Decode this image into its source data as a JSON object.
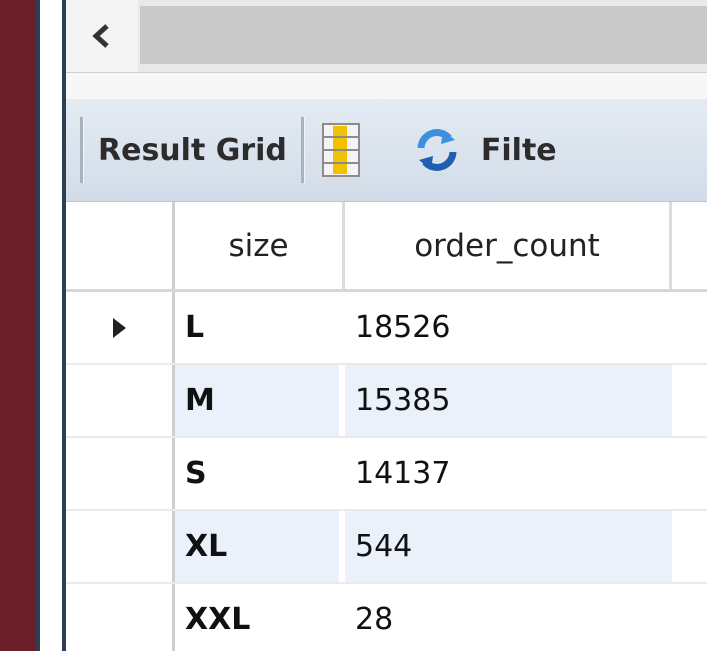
{
  "toolbar": {
    "result_grid_label": "Result Grid",
    "filter_label": "Filte"
  },
  "colors": {
    "page_background": "#6b1f2a",
    "alt_row": "#eaf1fb",
    "toolbar_top": "#e4ebf3",
    "toolbar_bottom": "#d2dce8"
  },
  "grid": {
    "columns": [
      "size",
      "order_count"
    ],
    "rows": [
      {
        "size": "L",
        "order_count": "18526"
      },
      {
        "size": "M",
        "order_count": "15385"
      },
      {
        "size": "S",
        "order_count": "14137"
      },
      {
        "size": "XL",
        "order_count": "544"
      },
      {
        "size": "XXL",
        "order_count": "28"
      }
    ]
  }
}
